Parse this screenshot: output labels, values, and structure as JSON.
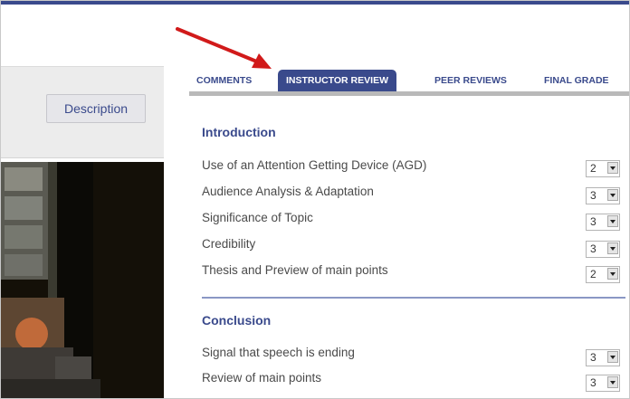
{
  "sidebar": {
    "description_label": "Description"
  },
  "tabs": [
    {
      "label": "COMMENTS",
      "active": false
    },
    {
      "label": "INSTRUCTOR REVIEW",
      "active": true
    },
    {
      "label": "PEER REVIEWS",
      "active": false
    },
    {
      "label": "FINAL GRADE",
      "active": false
    }
  ],
  "sections": [
    {
      "title": "Introduction",
      "rows": [
        {
          "label": "Use of an Attention Getting Device (AGD)",
          "score": "2"
        },
        {
          "label": "Audience Analysis & Adaptation",
          "score": "3"
        },
        {
          "label": "Significance of Topic",
          "score": "3"
        },
        {
          "label": "Credibility",
          "score": "3"
        },
        {
          "label": "Thesis and Preview of main points",
          "score": "2"
        }
      ]
    },
    {
      "title": "Conclusion",
      "rows": [
        {
          "label": "Signal that speech is ending",
          "score": "3"
        },
        {
          "label": "Review of main points",
          "score": "3"
        }
      ]
    }
  ],
  "colors": {
    "accent": "#3a4a8c",
    "arrow": "#d11a1a",
    "tab_rule": "#b9b9b9",
    "divider": "#8a97c4"
  },
  "icons": {
    "annotation": "red-arrow-icon",
    "dropdown": "dropdown-arrow-icon"
  }
}
